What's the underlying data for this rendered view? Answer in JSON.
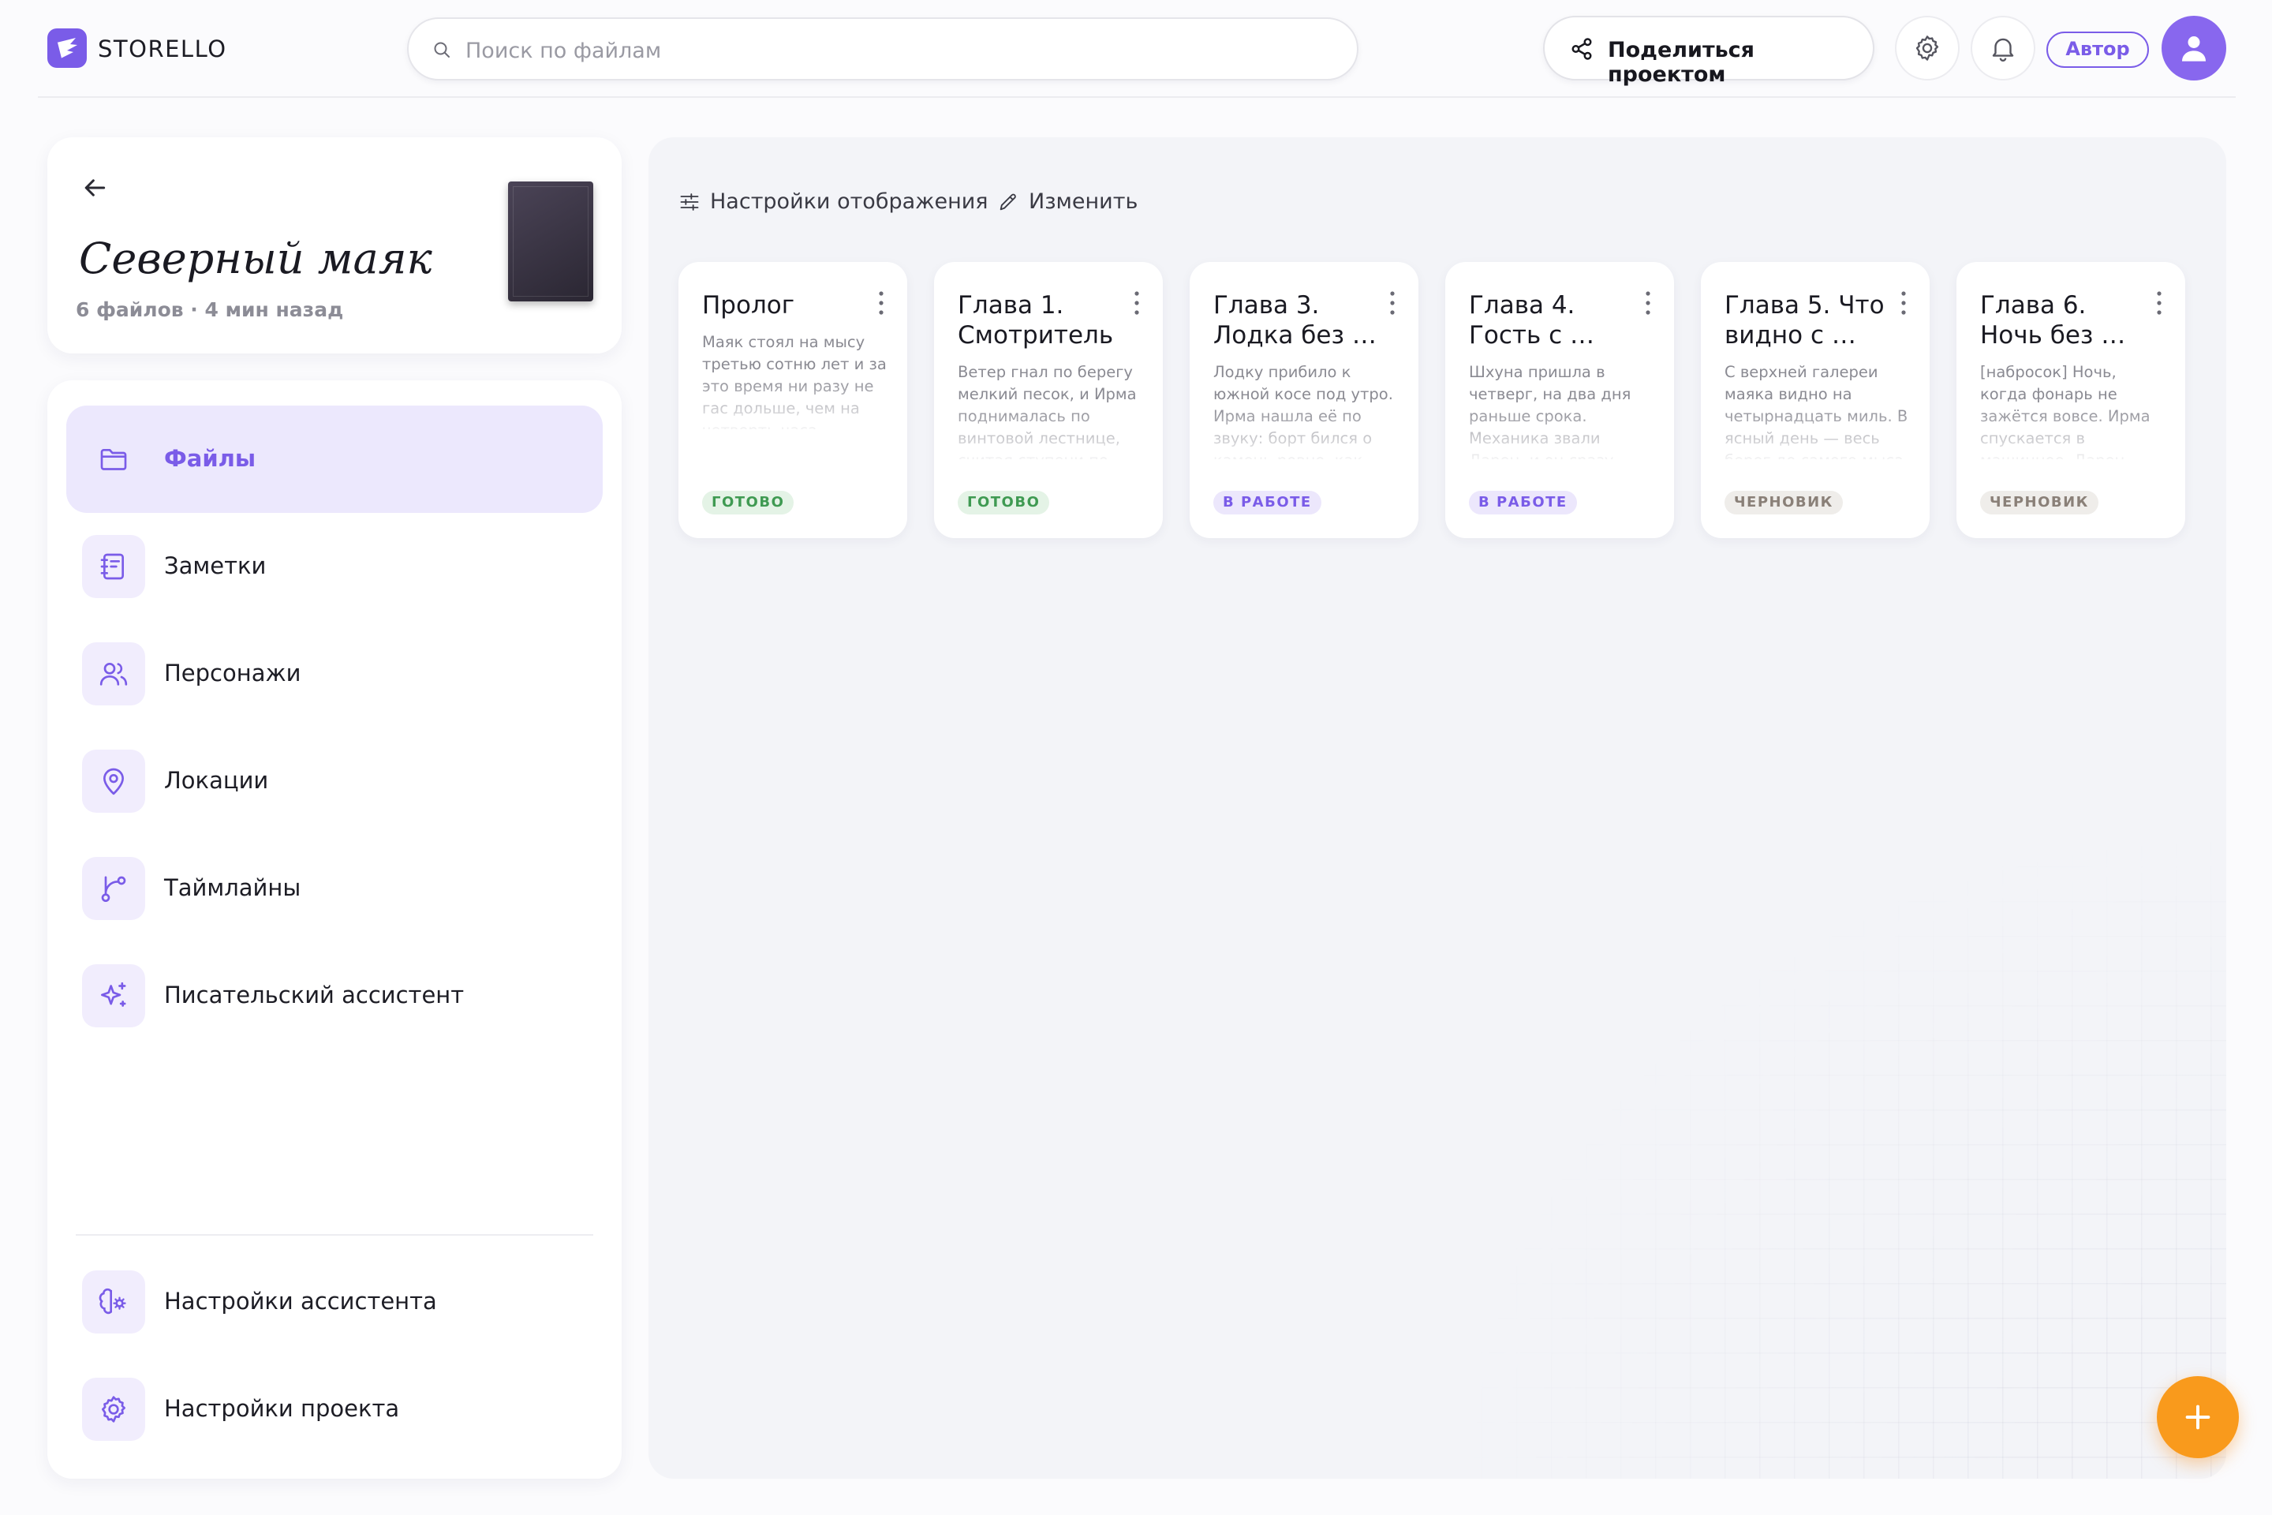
{
  "app": {
    "name": "STORELLO"
  },
  "search": {
    "placeholder": "Поиск по файлам"
  },
  "header": {
    "share_label": "Поделиться проектом",
    "role_label": "Автор"
  },
  "project": {
    "title": "Северный маяк",
    "meta": "6 файлов · 4 мин назад"
  },
  "sidebar": {
    "items": [
      {
        "label": "Файлы",
        "icon": "folder-icon",
        "active": true
      },
      {
        "label": "Заметки",
        "icon": "notebook-icon"
      },
      {
        "label": "Персонажи",
        "icon": "users-icon"
      },
      {
        "label": "Локации",
        "icon": "map-pin-icon"
      },
      {
        "label": "Таймлайны",
        "icon": "branch-icon"
      },
      {
        "label": "Писательский ассистент",
        "icon": "sparkles-icon"
      }
    ],
    "bottom": [
      {
        "label": "Настройки ассистента",
        "icon": "brain-cog-icon"
      },
      {
        "label": "Настройки проекта",
        "icon": "gear-icon"
      }
    ]
  },
  "toolbar": {
    "display_settings": "Настройки отображения",
    "edit": "Изменить"
  },
  "files": [
    {
      "title": "Пролог",
      "excerpt": "Маяк стоял на мысу третью сотню лет и за это время ни разу не гас дольше, чем на четверть часа.",
      "status": "ГОТОВО"
    },
    {
      "title": "Глава 1. Смотритель",
      "excerpt": "Ветер гнал по берегу мелкий песок, и Ирма поднималась по винтовой лестнице, считая ступени по",
      "status": "ГОТОВО"
    },
    {
      "title": "Глава 3. Лодка без …",
      "excerpt": "Лодку прибило к южной косе под утро. Ирма нашла её по звуку: борт бился о камень ровно, как",
      "status": "В РАБОТЕ"
    },
    {
      "title": "Глава 4. Гость с …",
      "excerpt": "Шхуна пришла в четверг, на два дня раньше срока. Механика звали Дарен, и он сразу",
      "status": "В РАБОТЕ"
    },
    {
      "title": "Глава 5. Что видно с …",
      "excerpt": "С верхней галереи маяка видно на четырнадцать миль. В ясный день — весь берег до самого мыса",
      "status": "ЧЕРНОВИК"
    },
    {
      "title": "Глава 6. Ночь без …",
      "excerpt": "[набросок] Ночь, когда фонарь не зажётся вовсе. Ирма спускается в машинное. Дарен",
      "status": "ЧЕРНОВИК"
    }
  ],
  "colors": {
    "accent": "#7a5ce8",
    "status_done_bg": "#e4f3e6",
    "status_done_fg": "#3f9a52",
    "status_wip_bg": "#ece7fc",
    "status_wip_fg": "#7a5ce8",
    "status_draft_bg": "#efedea",
    "status_draft_fg": "#8a8078",
    "fab": "#f99a1c"
  }
}
